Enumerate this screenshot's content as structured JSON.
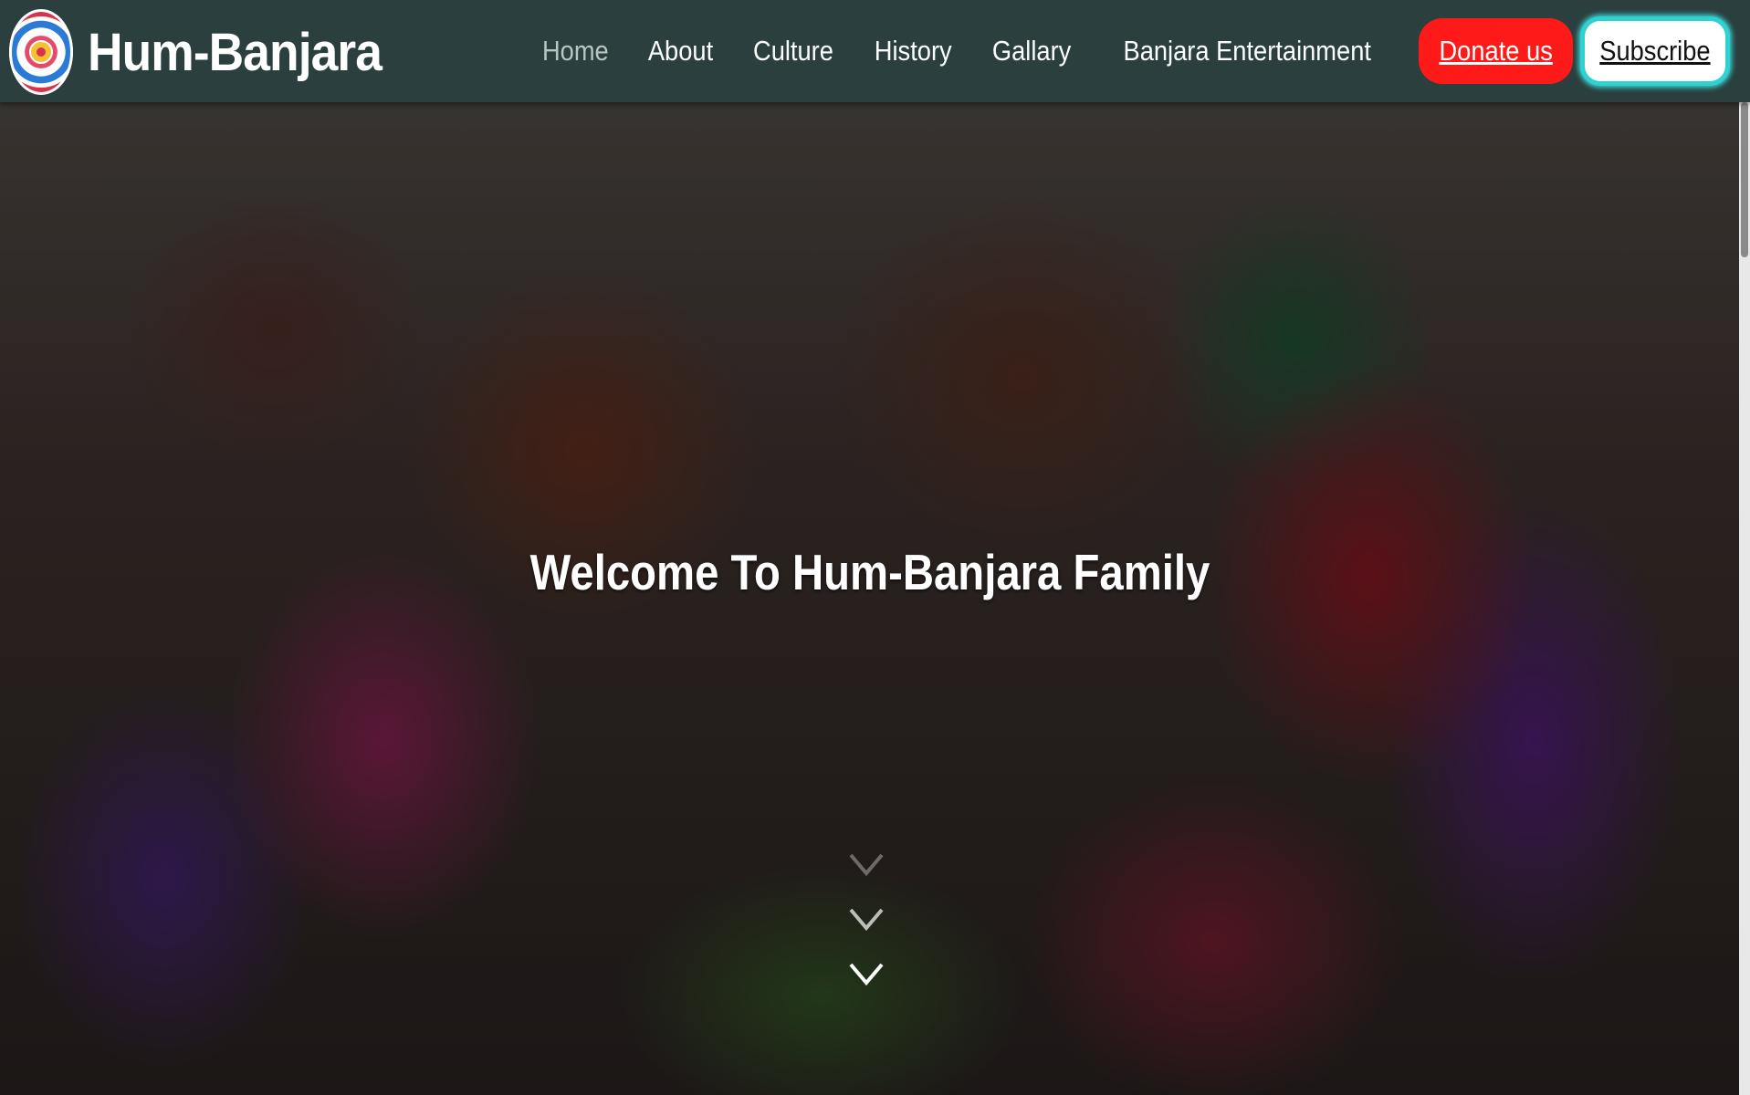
{
  "brand": {
    "name": "Hum-Banjara",
    "logo_icon": "hum-banjara-logo-icon"
  },
  "nav": {
    "items": [
      {
        "label": "Home",
        "active": true
      },
      {
        "label": "About",
        "active": false
      },
      {
        "label": "Culture",
        "active": false
      },
      {
        "label": "History",
        "active": false
      },
      {
        "label": "Gallary",
        "active": false
      },
      {
        "label": "Banjara Entertainment",
        "active": false
      }
    ],
    "donate_label": "Donate us",
    "subscribe_label": "Subscribe"
  },
  "hero": {
    "title": "Welcome To Hum-Banjara Family",
    "scroll_icon": "chevrons-down-icon"
  },
  "colors": {
    "navbar_bg": "#2a3f3e",
    "donate_bg": "#ff1a1a",
    "subscribe_border": "#2fd1d1",
    "active_link": "#b9c4c4"
  }
}
